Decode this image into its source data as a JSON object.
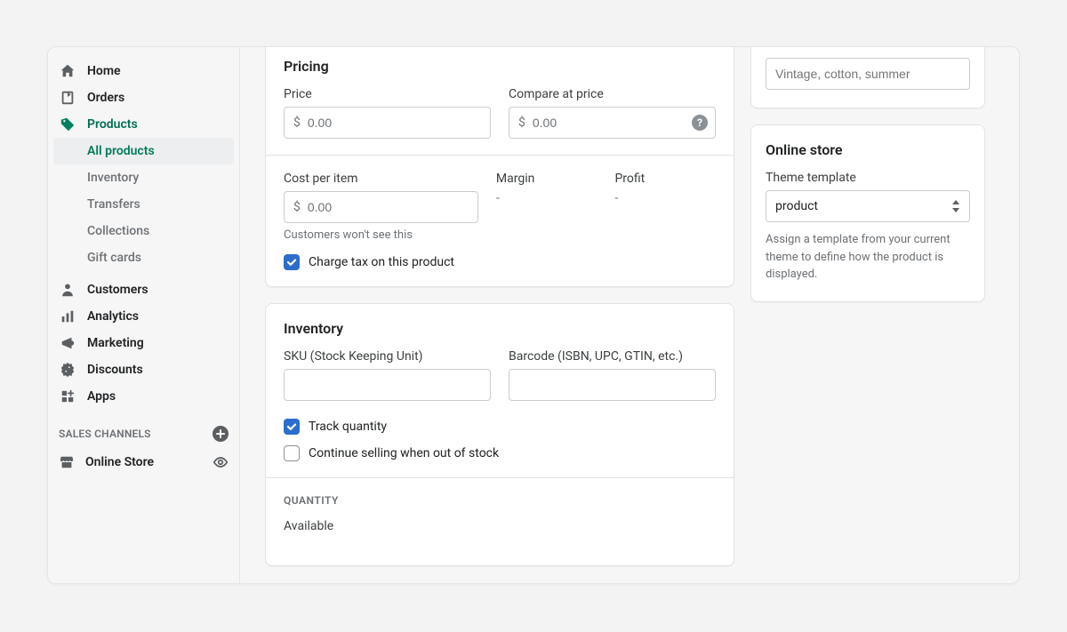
{
  "sidebar": {
    "items": [
      {
        "label": "Home"
      },
      {
        "label": "Orders"
      },
      {
        "label": "Products"
      },
      {
        "label": "Customers"
      },
      {
        "label": "Analytics"
      },
      {
        "label": "Marketing"
      },
      {
        "label": "Discounts"
      },
      {
        "label": "Apps"
      }
    ],
    "products_sub": [
      {
        "label": "All products"
      },
      {
        "label": "Inventory"
      },
      {
        "label": "Transfers"
      },
      {
        "label": "Collections"
      },
      {
        "label": "Gift cards"
      }
    ],
    "sales_channels_heading": "SALES CHANNELS",
    "channels": [
      {
        "label": "Online Store"
      }
    ]
  },
  "pricing": {
    "title": "Pricing",
    "price_label": "Price",
    "price_value": "0.00",
    "compare_label": "Compare at price",
    "compare_value": "0.00",
    "currency": "$",
    "cost_label": "Cost per item",
    "cost_value": "0.00",
    "cost_helper": "Customers won't see this",
    "margin_label": "Margin",
    "margin_value": "-",
    "profit_label": "Profit",
    "profit_value": "-",
    "charge_tax_label": "Charge tax on this product"
  },
  "inventory": {
    "title": "Inventory",
    "sku_label": "SKU (Stock Keeping Unit)",
    "barcode_label": "Barcode (ISBN, UPC, GTIN, etc.)",
    "track_label": "Track quantity",
    "continue_label": "Continue selling when out of stock",
    "quantity_heading": "QUANTITY",
    "available_label": "Available"
  },
  "tags": {
    "placeholder": "Vintage, cotton, summer"
  },
  "online_store": {
    "title": "Online store",
    "template_label": "Theme template",
    "template_value": "product",
    "template_help": "Assign a template from your current theme to define how the product is displayed."
  }
}
